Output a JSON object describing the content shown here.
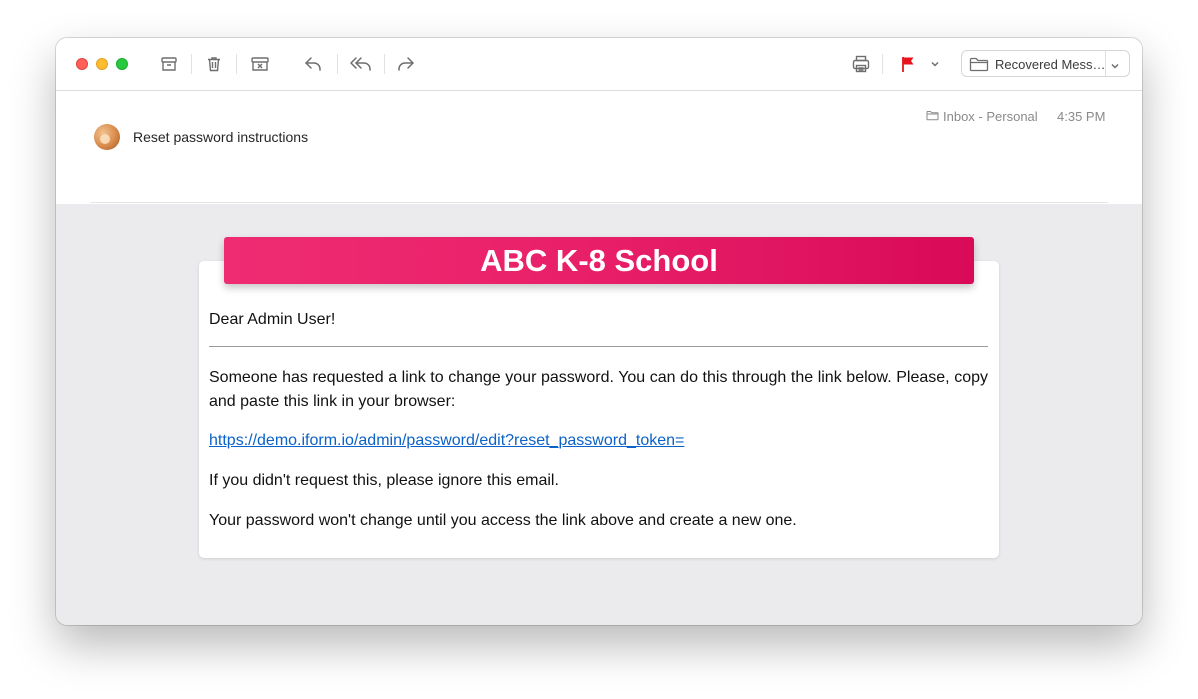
{
  "toolbar": {
    "icons": [
      "archive-icon",
      "trash-icon",
      "junk-icon",
      "reply-icon",
      "reply-all-icon",
      "forward-icon",
      "print-icon",
      "flag-icon",
      "chevron-down-icon"
    ],
    "flag_color": "#e8131d",
    "folder_select": "Recovered Messages"
  },
  "message": {
    "subject": "Reset password instructions",
    "mailbox": "Inbox - Personal",
    "time": "4:35 PM"
  },
  "email": {
    "banner": "ABC K-8 School",
    "banner_color": "#e81f68",
    "greeting": "Dear Admin User!",
    "paragraph1": "Someone has requested a link to change your password. You can do this through the link below. Please, copy and paste this link in your browser:",
    "link": "https://demo.iform.io/admin/password/edit?reset_password_token=",
    "paragraph2": "If you didn't request this, please ignore this email.",
    "paragraph3": "Your password won't change until you access the link above and create a new one."
  }
}
